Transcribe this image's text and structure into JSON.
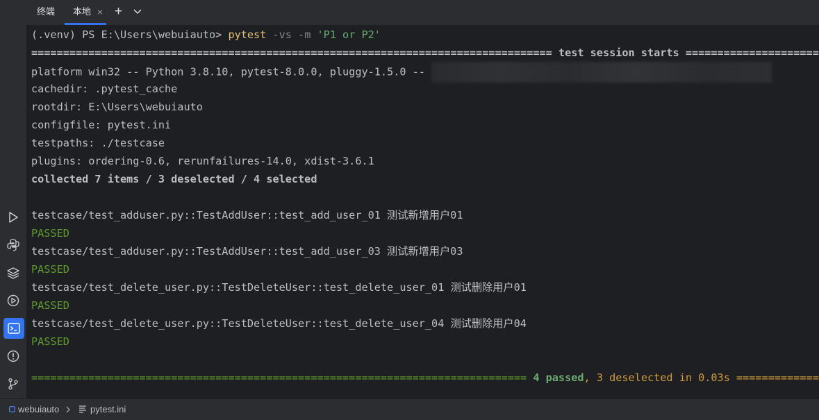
{
  "tabs": {
    "terminal_label": "终端",
    "local_label": "本地",
    "close_glyph": "×",
    "add_glyph": "+"
  },
  "toolbar": {
    "icons": [
      "run-icon",
      "python-console-icon",
      "layers-icon",
      "services-icon",
      "terminal-icon",
      "problems-icon",
      "git-icon"
    ]
  },
  "terminal": {
    "prompt_prefix": "(.venv) PS E:\\Users\\webuiauto> ",
    "command": "pytest",
    "command_flags": " -vs -m ",
    "command_arg": "'P1 or P2'",
    "session_start_left": "================================================================================== ",
    "session_start_text": "test session starts",
    "session_start_right": " ================================",
    "platform": "platform win32 -- Python 3.8.10, pytest-8.0.0, pluggy-1.5.0 -- ",
    "cachedir": "cachedir: .pytest_cache",
    "rootdir": "rootdir: E:\\Users\\webuiauto",
    "configfile": "configfile: pytest.ini",
    "testpaths": "testpaths: ./testcase",
    "plugins": "plugins: ordering-0.6, rerunfailures-14.0, xdist-3.6.1",
    "collected": "collected 7 items / 3 deselected / 4 selected",
    "results": [
      {
        "test": "testcase/test_adduser.py::TestAddUser::test_add_user_01 测试新增用户01",
        "status": "PASSED"
      },
      {
        "test": "testcase/test_adduser.py::TestAddUser::test_add_user_03 测试新增用户03",
        "status": "PASSED"
      },
      {
        "test": "testcase/test_delete_user.py::TestDeleteUser::test_delete_user_01 测试删除用户01",
        "status": "PASSED"
      },
      {
        "test": "testcase/test_delete_user.py::TestDeleteUser::test_delete_user_04 测试删除用户04",
        "status": "PASSED"
      }
    ],
    "summary_left": "============================================================================== ",
    "summary_passed": "4 passed",
    "summary_sep": ", ",
    "summary_deselected": "3 deselected",
    "summary_time": " in 0.03s",
    "summary_right": " ================================"
  },
  "statusbar": {
    "project": "webuiauto",
    "file": "pytest.ini"
  },
  "colors": {
    "accent": "#3574f0",
    "passed": "#5f9c2e",
    "command": "#e5c07b",
    "string": "#6aab73"
  }
}
